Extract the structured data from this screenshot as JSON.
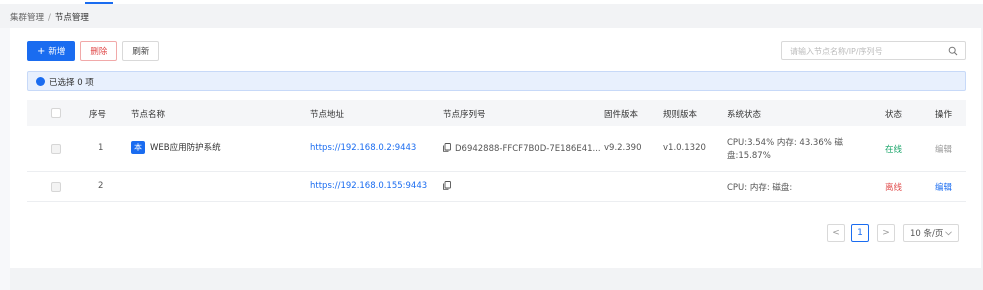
{
  "breadcrumb": {
    "parent": "集群管理",
    "separator": "/",
    "current": "节点管理"
  },
  "toolbar": {
    "add_label": "新增",
    "add_icon": "+",
    "delete_label": "删除",
    "refresh_label": "刷新"
  },
  "search": {
    "placeholder": "请输入节点名称/IP/序列号",
    "icon": "search-icon"
  },
  "selection": {
    "text": "已选择 0 项"
  },
  "table": {
    "columns": {
      "index": "序号",
      "name": "节点名称",
      "address": "节点地址",
      "serial": "节点序列号",
      "firmware": "固件版本",
      "rules": "规则版本",
      "system_status": "系统状态",
      "status": "状态",
      "actions": "操作"
    },
    "rows": [
      {
        "index": "1",
        "badge": "本",
        "name": "WEB应用防护系统",
        "address": "https://192.168.0.2:9443",
        "serial": "D6942888-FFCF7B0D-7E186E41...",
        "firmware": "v9.2.390",
        "rules": "v1.0.1320",
        "system_status_line1": "CPU:3.54% 内存: 43.36% 磁",
        "system_status_line2": "盘:15.87%",
        "status": "在线",
        "action": "编辑"
      },
      {
        "index": "2",
        "name": "",
        "address": "https://192.168.0.155:9443",
        "serial": "",
        "firmware": "",
        "rules": "",
        "system_status_line1": "CPU: 内存: 磁盘:",
        "status": "离线",
        "action": "编辑"
      }
    ]
  },
  "pagination": {
    "prev": "<",
    "current_page": "1",
    "next": ">",
    "page_size": "10 条/页"
  },
  "colors": {
    "primary": "#1a6cf0",
    "danger": "#e04a4a",
    "online": "#1aa56a"
  }
}
